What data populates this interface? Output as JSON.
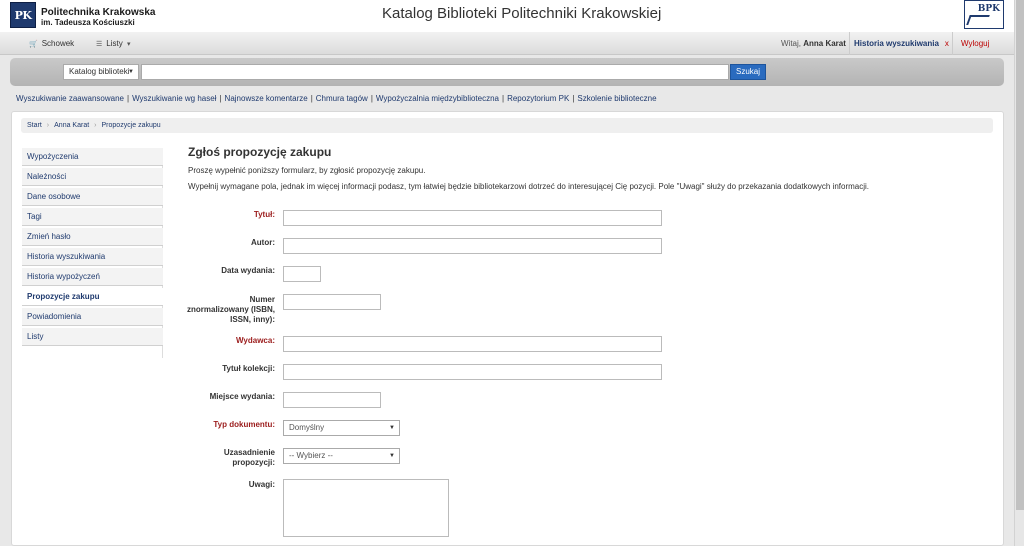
{
  "header": {
    "logo_abbr": "PK",
    "university_line1": "Politechnika Krakowska",
    "university_line2": "im. Tadeusza Kościuszki",
    "site_title": "Katalog Biblioteki Politechniki Krakowskiej",
    "library_logo": "BPK"
  },
  "navbar": {
    "cart_label": "Schowek",
    "lists_label": "Listy",
    "welcome_prefix": "Witaj,",
    "user_name": "Anna Karat",
    "history_label": "Historia wyszukiwania",
    "history_close": "x",
    "logout_label": "Wyloguj"
  },
  "search": {
    "scope_value": "Katalog biblioteki",
    "query_value": "",
    "button_label": "Szukaj"
  },
  "links": [
    "Wyszukiwanie zaawansowane",
    "Wyszukiwanie wg haseł",
    "Najnowsze komentarze",
    "Chmura tagów",
    "Wypożyczalnia międzybiblioteczna",
    "Repozytorium PK",
    "Szkolenie biblioteczne"
  ],
  "breadcrumb": [
    "Start",
    "Anna Karat",
    "Propozycje zakupu"
  ],
  "sidebar": {
    "items": [
      {
        "label": "Wypożyczenia"
      },
      {
        "label": "Należności"
      },
      {
        "label": "Dane osobowe"
      },
      {
        "label": "Tagi"
      },
      {
        "label": "Zmień hasło"
      },
      {
        "label": "Historia wyszukiwania"
      },
      {
        "label": "Historia wypożyczeń"
      },
      {
        "label": "Propozycje zakupu"
      },
      {
        "label": "Powiadomienia"
      },
      {
        "label": "Listy"
      }
    ],
    "active": "Propozycje zakupu"
  },
  "form": {
    "title": "Zgłoś propozycję zakupu",
    "intro1": "Proszę wypełnić poniższy formularz, by zgłosić propozycję zakupu.",
    "intro2": "Wypełnij wymagane pola, jednak im więcej informacji podasz, tym łatwiej będzie bibliotekarzowi dotrzeć do interesującej Cię pozycji. Pole \"Uwagi\" służy do przekazania dodatkowych informacji.",
    "fields": {
      "title_label": "Tytuł:",
      "author_label": "Autor:",
      "date_label": "Data wydania:",
      "isbn_label": "Numer znormalizowany (ISBN, ISSN, inny):",
      "publisher_label": "Wydawca:",
      "series_label": "Tytuł kolekcji:",
      "place_label": "Miejsce wydania:",
      "doctype_label": "Typ dokumentu:",
      "doctype_value": "Domyślny",
      "reason_label": "Uzasadnienie propozycji:",
      "reason_value": "-- Wybierz --",
      "notes_label": "Uwagi:"
    }
  },
  "colors": {
    "brand_navy": "#1f3a6e",
    "required_red": "#9b1c1c",
    "search_button": "#2a6bbf",
    "logout_red": "#bb0000"
  }
}
